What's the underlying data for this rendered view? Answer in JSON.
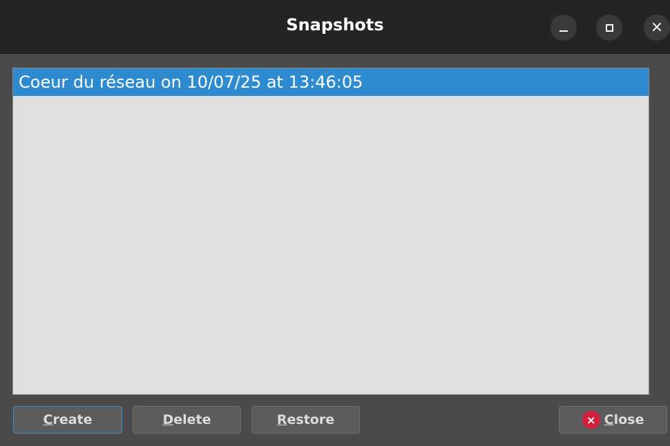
{
  "window": {
    "title": "Snapshots",
    "controls": {
      "minimize_icon": "minimize-icon",
      "maximize_icon": "maximize-icon",
      "close_icon": "close-icon",
      "close_glyph": "×"
    }
  },
  "snapshots": {
    "items": [
      {
        "label": "Coeur du réseau on 10/07/25 at 13:46:05",
        "selected": true
      }
    ]
  },
  "buttons": {
    "create": {
      "mnemonic": "C",
      "rest": "reate"
    },
    "delete": {
      "mnemonic": "D",
      "rest": "elete"
    },
    "restore": {
      "mnemonic": "R",
      "rest": "estore"
    },
    "close": {
      "mnemonic": "C",
      "rest": "lose",
      "icon_glyph": "×"
    }
  },
  "colors": {
    "titlebar": "#242424",
    "selection": "#2e8bd0",
    "list_background": "#e0e0e0",
    "close_icon_red": "#d21f3c"
  }
}
